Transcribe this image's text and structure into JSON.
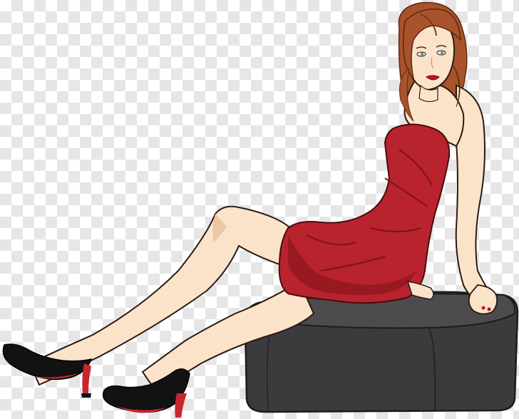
{
  "image": {
    "subject": "illustrated-woman-sitting-on-ottoman",
    "background": "transparency-checkerboard",
    "colors": {
      "checker_light": "#ffffff",
      "checker_dark": "#e6e6e6",
      "skin": "#fbe3c9",
      "skin_shadow": "#ebc7a4",
      "dress": "#b8232d",
      "dress_dark": "#7f1219",
      "hair": "#a8532c",
      "hair_dark": "#7a3518",
      "ottoman": "#3b3b3d",
      "ottoman_top": "#4c4c4f",
      "shoe": "#121212",
      "sole": "#c9242e",
      "lips": "#c0141e",
      "eyes": "#5f9a8c",
      "outline": "#2a1a14"
    }
  }
}
